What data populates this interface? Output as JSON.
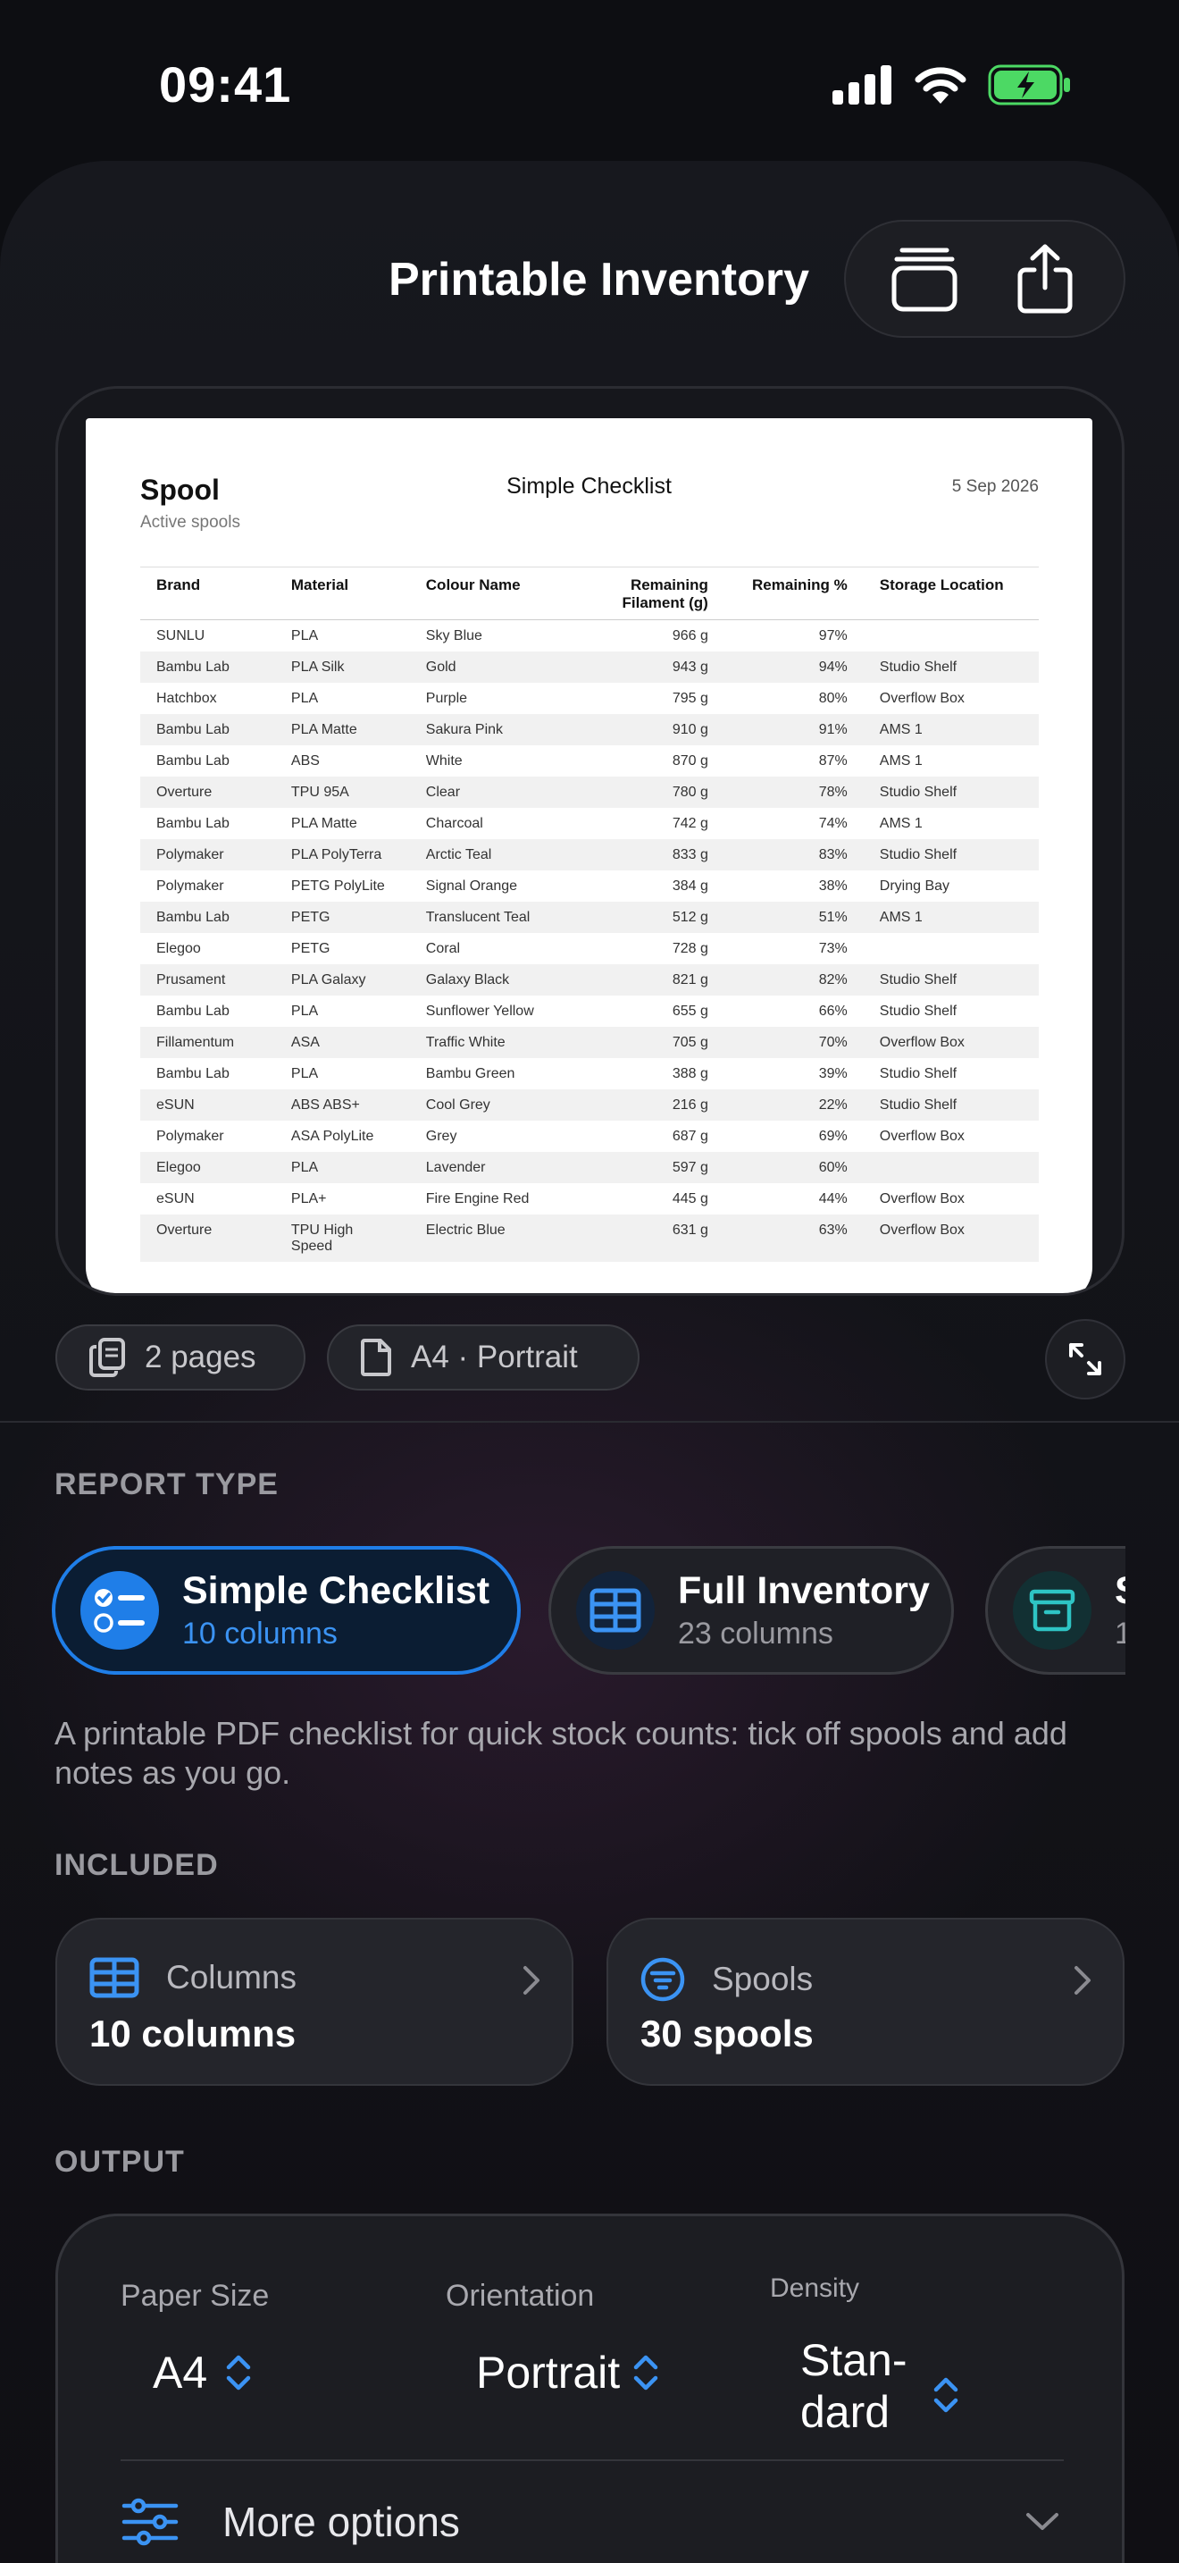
{
  "status": {
    "time": "09:41"
  },
  "nav": {
    "title": "Printable Inventory"
  },
  "preview": {
    "title": "Spool",
    "subtitle": "Active spools",
    "report_name": "Simple Checklist",
    "date": "5 Sep 2026",
    "columns": [
      "Brand",
      "Material",
      "Colour Name",
      "Remaining Filament (g)",
      "Remaining %",
      "Storage Location"
    ],
    "rows": [
      [
        "SUNLU",
        "PLA",
        "Sky Blue",
        "966 g",
        "97%",
        ""
      ],
      [
        "Bambu Lab",
        "PLA Silk",
        "Gold",
        "943 g",
        "94%",
        "Studio Shelf"
      ],
      [
        "Hatchbox",
        "PLA",
        "Purple",
        "795 g",
        "80%",
        "Overflow Box"
      ],
      [
        "Bambu Lab",
        "PLA Matte",
        "Sakura Pink",
        "910 g",
        "91%",
        "AMS 1"
      ],
      [
        "Bambu Lab",
        "ABS",
        "White",
        "870 g",
        "87%",
        "AMS 1"
      ],
      [
        "Overture",
        "TPU 95A",
        "Clear",
        "780 g",
        "78%",
        "Studio Shelf"
      ],
      [
        "Bambu Lab",
        "PLA Matte",
        "Charcoal",
        "742 g",
        "74%",
        "AMS 1"
      ],
      [
        "Polymaker",
        "PLA PolyTerra",
        "Arctic Teal",
        "833 g",
        "83%",
        "Studio Shelf"
      ],
      [
        "Polymaker",
        "PETG PolyLite",
        "Signal Orange",
        "384 g",
        "38%",
        "Drying Bay"
      ],
      [
        "Bambu Lab",
        "PETG",
        "Translucent Teal",
        "512 g",
        "51%",
        "AMS 1"
      ],
      [
        "Elegoo",
        "PETG",
        "Coral",
        "728 g",
        "73%",
        ""
      ],
      [
        "Prusament",
        "PLA Galaxy",
        "Galaxy Black",
        "821 g",
        "82%",
        "Studio Shelf"
      ],
      [
        "Bambu Lab",
        "PLA",
        "Sunflower Yellow",
        "655 g",
        "66%",
        "Studio Shelf"
      ],
      [
        "Fillamentum",
        "ASA",
        "Traffic White",
        "705 g",
        "70%",
        "Overflow Box"
      ],
      [
        "Bambu Lab",
        "PLA",
        "Bambu Green",
        "388 g",
        "39%",
        "Studio Shelf"
      ],
      [
        "eSUN",
        "ABS ABS+",
        "Cool Grey",
        "216 g",
        "22%",
        "Studio Shelf"
      ],
      [
        "Polymaker",
        "ASA PolyLite",
        "Grey",
        "687 g",
        "69%",
        "Overflow Box"
      ],
      [
        "Elegoo",
        "PLA",
        "Lavender",
        "597 g",
        "60%",
        ""
      ],
      [
        "eSUN",
        "PLA+",
        "Fire Engine Red",
        "445 g",
        "44%",
        "Overflow Box"
      ],
      [
        "Overture",
        "TPU High Speed",
        "Electric Blue",
        "631 g",
        "63%",
        "Overflow Box"
      ]
    ]
  },
  "chips": {
    "pages": "2 pages",
    "format": "A4 · Portrait"
  },
  "report_type": {
    "label": "REPORT TYPE",
    "options": [
      {
        "name": "Simple Checklist",
        "columns": "10 columns",
        "icon": "checklist-icon",
        "selected": true
      },
      {
        "name": "Full Inventory",
        "columns": "23 columns",
        "icon": "table-icon",
        "selected": false
      },
      {
        "name": "S",
        "columns": "1",
        "icon": "archive-box-icon",
        "selected": false
      }
    ],
    "description": "A printable PDF checklist for quick stock counts: tick off spools and add notes as you go."
  },
  "included": {
    "label": "INCLUDED",
    "columns": {
      "title": "Columns",
      "value": "10 columns"
    },
    "spools": {
      "title": "Spools",
      "value": "30 spools"
    }
  },
  "output": {
    "label": "OUTPUT",
    "paper_size": {
      "label": "Paper Size",
      "value": "A4"
    },
    "orientation": {
      "label": "Orientation",
      "value": "Portrait"
    },
    "density": {
      "label": "Density",
      "value_line1": "Stan-",
      "value_line2": "dard"
    },
    "more_options": "More options"
  },
  "colors": {
    "accent": "#1f7ee8",
    "accent_text": "#3b93f3",
    "teal": "#2ec4c4"
  }
}
